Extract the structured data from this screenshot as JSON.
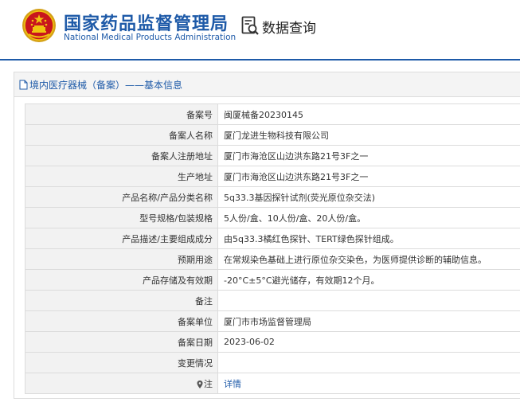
{
  "header": {
    "title_cn": "国家药品监督管理局",
    "title_en": "National Medical Products Administration",
    "query_label": "数据查询"
  },
  "panel": {
    "title": "境内医疗器械（备案）——基本信息"
  },
  "rows": [
    {
      "label": "备案号",
      "value": "闽厦械备20230145"
    },
    {
      "label": "备案人名称",
      "value": "厦门龙进生物科技有限公司"
    },
    {
      "label": "备案人注册地址",
      "value": "厦门市海沧区山边洪东路21号3F之一"
    },
    {
      "label": "生产地址",
      "value": "厦门市海沧区山边洪东路21号3F之一"
    },
    {
      "label": "产品名称/产品分类名称",
      "value": "5q33.3基因探针试剂(荧光原位杂交法)"
    },
    {
      "label": "型号规格/包装规格",
      "value": "5人份/盒、10人份/盒、20人份/盒。"
    },
    {
      "label": "产品描述/主要组成成分",
      "value": "由5q33.3橘红色探针、TERT绿色探针组成。"
    },
    {
      "label": "预期用途",
      "value": "在常规染色基础上进行原位杂交染色，为医师提供诊断的辅助信息。"
    },
    {
      "label": "产品存储及有效期",
      "value": "-20°C±5°C避光储存，有效期12个月。"
    },
    {
      "label": "备注",
      "value": ""
    },
    {
      "label": "备案单位",
      "value": "厦门市市场监督管理局"
    },
    {
      "label": "备案日期",
      "value": "2023-06-02"
    },
    {
      "label": "变更情况",
      "value": ""
    },
    {
      "label": "注",
      "value": "详情"
    }
  ]
}
